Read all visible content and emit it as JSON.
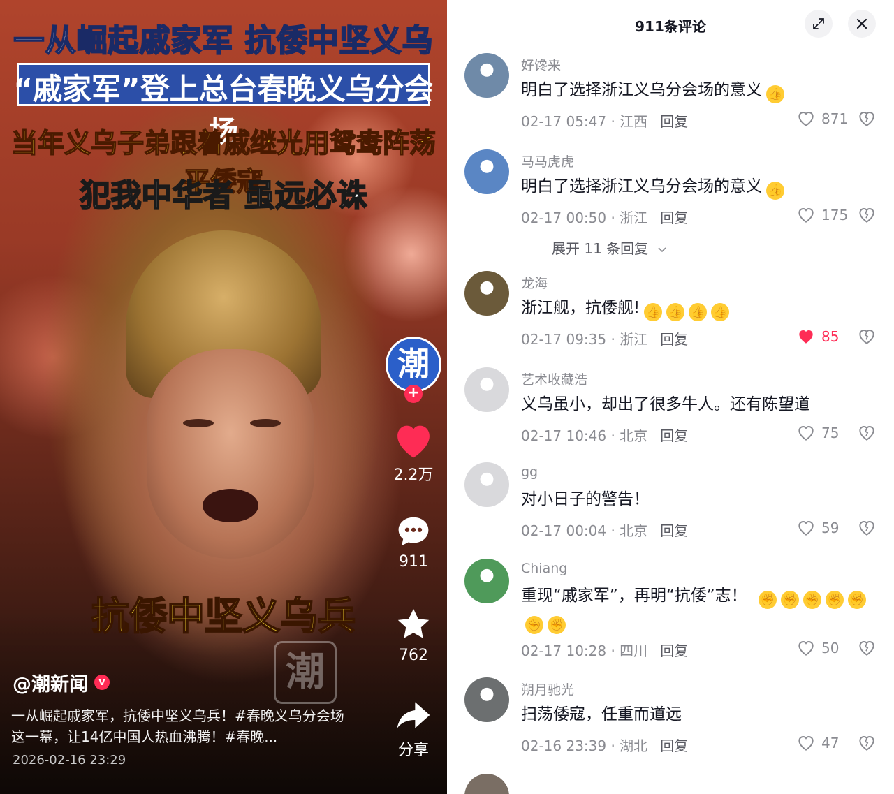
{
  "video": {
    "title_line1": "一从崛起戚家军 抗倭中坚义乌兵",
    "title_line2": "“戚家军”登上总台春晚义乌分会场",
    "title_line3": "当年义乌子弟跟着戚继光用鸳鸯阵荡平倭寇",
    "title_line4": "犯我中华者 虽远必诛",
    "caption": "抗倭中坚义乌兵",
    "watermark": "潮",
    "author": "@潮新闻",
    "description": "一从崛起戚家军，抗倭中坚义乌兵！#春晚义乌分会场 这一幕，让14亿中国人热血沸腾！#春晚...",
    "date": "2026-02-16 23:29",
    "avatar_char": "潮",
    "likes": "2.2万",
    "comments": "911",
    "favorites": "762",
    "share_label": "分享"
  },
  "panel": {
    "title": "911条评论",
    "expand_replies": "展开 11 条回复"
  },
  "comments": [
    {
      "user": "好馋来",
      "text": "明白了选择浙江义乌分会场的意义",
      "emoji": [
        "👍"
      ],
      "time": "02-17 05:47 · 江西",
      "reply": "回复",
      "likes": "871",
      "liked": false,
      "avatar_color": "#6f8aa8"
    },
    {
      "user": "马马虎虎",
      "text": "明白了选择浙江义乌分会场的意义",
      "emoji": [
        "👍"
      ],
      "time": "02-17 00:50 · 浙江",
      "reply": "回复",
      "likes": "175",
      "liked": false,
      "avatar_color": "#5a86c4"
    },
    {
      "user": "龙海",
      "text": "浙江舰，抗倭舰!",
      "emoji": [
        "👍",
        "👍",
        "👍",
        "👍"
      ],
      "time": "02-17 09:35 · 浙江",
      "reply": "回复",
      "likes": "85",
      "liked": true,
      "avatar_color": "#6b5a3a"
    },
    {
      "user": "艺术收藏浩",
      "text": "义乌虽小，却出了很多牛人。还有陈望道",
      "emoji": [],
      "time": "02-17 10:46 · 北京",
      "reply": "回复",
      "likes": "75",
      "liked": false,
      "avatar_color": "#d9d9dc"
    },
    {
      "user": "gg",
      "text": "对小日子的警告！",
      "emoji": [],
      "time": "02-17 00:04 · 北京",
      "reply": "回复",
      "likes": "59",
      "liked": false,
      "avatar_color": "#d9d9dc"
    },
    {
      "user": "Chiang",
      "text": "重现“戚家军”，再明“抗倭”志！",
      "emoji": [
        "✊",
        "✊",
        "✊",
        "✊",
        "✊",
        "✊",
        "✊"
      ],
      "time": "02-17 10:28 · 四川",
      "reply": "回复",
      "likes": "50",
      "liked": false,
      "avatar_color": "#4f9a5a"
    },
    {
      "user": "朔月驰光",
      "text": "扫荡倭寇，任重而道远",
      "emoji": [],
      "time": "02-16 23:39 · 湖北",
      "reply": "回复",
      "likes": "47",
      "liked": false,
      "avatar_color": "#6c6f70"
    }
  ],
  "colors": {
    "like_red": "#fe2c55",
    "text_gray": "#8a8b91",
    "brand_blue": "#2b5fc9"
  }
}
